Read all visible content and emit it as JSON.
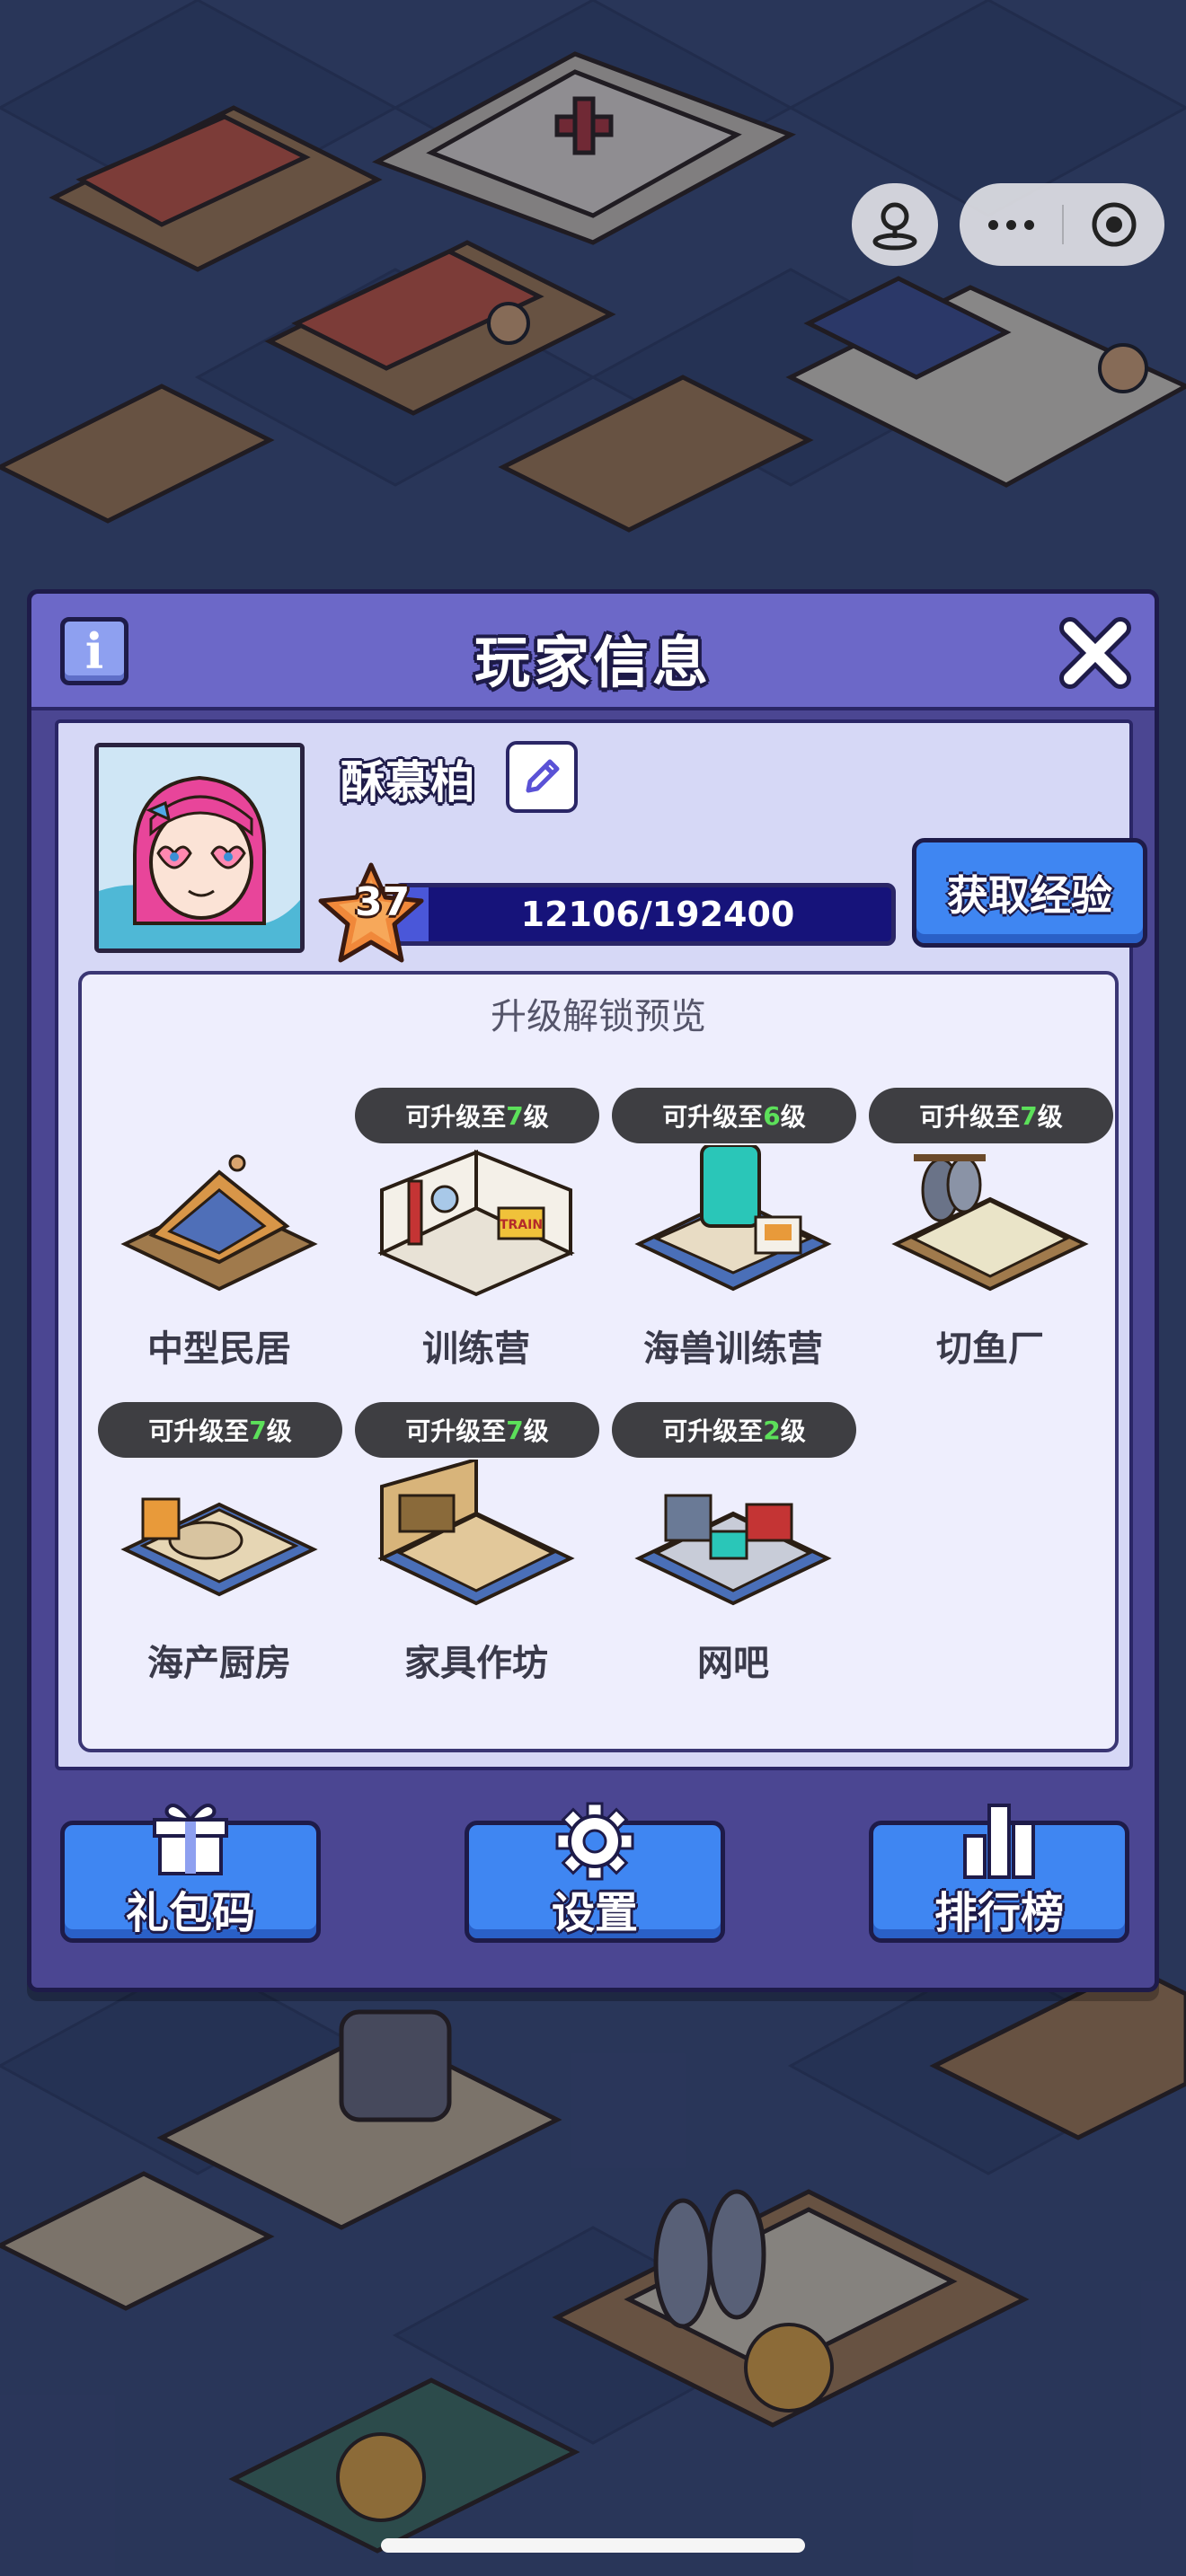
{
  "dialog": {
    "title": "玩家信息",
    "info_glyph": "i",
    "close_icon": "close-x-icon"
  },
  "player": {
    "name": "酥慕柏",
    "level": "37",
    "xp_text": "12106/192400",
    "xp_current": 12106,
    "xp_max": 192400,
    "gain_xp_label": "获取经验"
  },
  "preview": {
    "title": "升级解锁预览",
    "buildings": [
      {
        "name": "中型民居",
        "tag_prefix": "",
        "tag_level": "",
        "tag_suffix": ""
      },
      {
        "name": "训练营",
        "tag_prefix": "可升级至",
        "tag_level": "7",
        "tag_suffix": "级"
      },
      {
        "name": "海兽训练营",
        "tag_prefix": "可升级至",
        "tag_level": "6",
        "tag_suffix": "级"
      },
      {
        "name": "切鱼厂",
        "tag_prefix": "可升级至",
        "tag_level": "7",
        "tag_suffix": "级"
      },
      {
        "name": "海产厨房",
        "tag_prefix": "可升级至",
        "tag_level": "7",
        "tag_suffix": "级"
      },
      {
        "name": "家具作坊",
        "tag_prefix": "可升级至",
        "tag_level": "7",
        "tag_suffix": "级"
      },
      {
        "name": "网吧",
        "tag_prefix": "可升级至",
        "tag_level": "2",
        "tag_suffix": "级"
      }
    ],
    "train_sign": "TRAIN"
  },
  "bottom_buttons": {
    "gift_code": "礼包码",
    "settings": "设置",
    "leaderboard": "排行榜"
  },
  "colors": {
    "dialog_bg": "#4b4692",
    "header_bg": "#6c68c8",
    "panel_bg": "#d6d8f6",
    "button_blue": "#3f86f2",
    "xp_bar_bg": "#16137a",
    "tag_level_green": "#5ce05a"
  }
}
